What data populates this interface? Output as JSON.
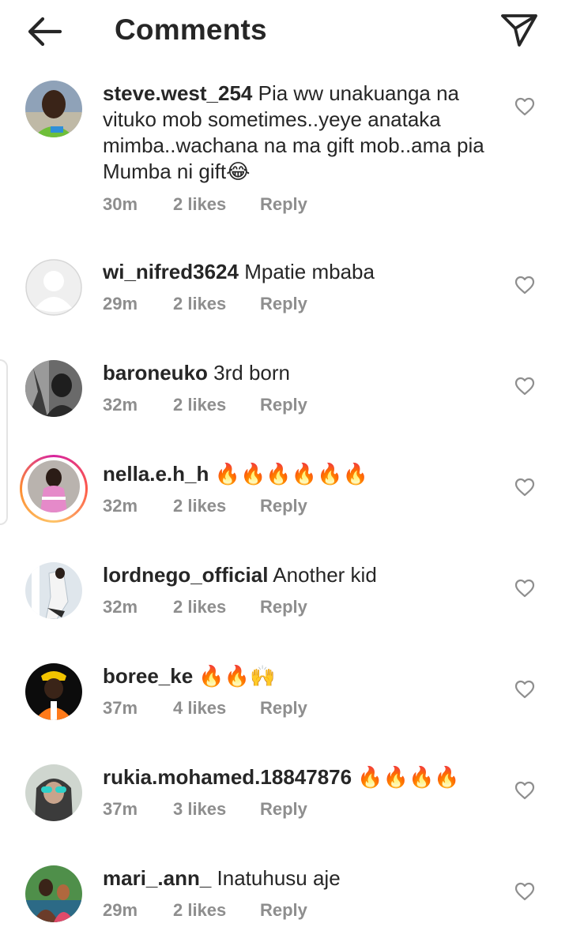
{
  "header": {
    "title": "Comments",
    "back_icon": "arrow-left-icon",
    "share_icon": "paper-plane-icon"
  },
  "comments": [
    {
      "username": "steve.west_254",
      "text": "Pia ww unakuanga na vituko mob sometimes..yeye anataka mimba..wachana na ma gift mob..ama pia Mumba ni gift😂",
      "time": "30m",
      "likes": "2 likes",
      "reply": "Reply",
      "avatar": "photo-man-green-shirt",
      "story_ring": false
    },
    {
      "username": "wi_nifred3624",
      "text": "Mpatie mbaba",
      "time": "29m",
      "likes": "2 likes",
      "reply": "Reply",
      "avatar": "default-user-icon",
      "story_ring": false
    },
    {
      "username": "baroneuko",
      "text": "3rd born",
      "time": "32m",
      "likes": "2 likes",
      "reply": "Reply",
      "avatar": "photo-black-white-portrait",
      "story_ring": false
    },
    {
      "username": "nella.e.h_h",
      "text": "🔥🔥🔥🔥🔥🔥",
      "time": "32m",
      "likes": "2 likes",
      "reply": "Reply",
      "avatar": "photo-girl-pink-top",
      "story_ring": true
    },
    {
      "username": "lordnego_official",
      "text": "Another kid",
      "time": "32m",
      "likes": "2 likes",
      "reply": "Reply",
      "avatar": "photo-man-white-outfit",
      "story_ring": false
    },
    {
      "username": "boree_ke",
      "text": "🔥🔥🙌",
      "time": "37m",
      "likes": "4 likes",
      "reply": "Reply",
      "avatar": "photo-man-orange-shirt",
      "story_ring": false
    },
    {
      "username": "rukia.mohamed.18847876",
      "text": "🔥🔥🔥🔥",
      "time": "37m",
      "likes": "3 likes",
      "reply": "Reply",
      "avatar": "photo-woman-hijab-sunglasses",
      "story_ring": false
    },
    {
      "username": "mari_.ann_",
      "text": "Inatuhusu aje",
      "time": "29m",
      "likes": "2 likes",
      "reply": "Reply",
      "avatar": "photo-couple-outdoor",
      "story_ring": false
    }
  ],
  "colors": {
    "text": "#262626",
    "meta": "#8e8e8e",
    "heart": "#8e8e8e"
  }
}
